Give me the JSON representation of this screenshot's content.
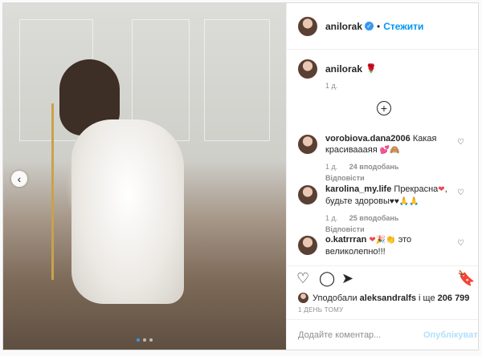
{
  "post": {
    "author": "anilorak",
    "follow_label": "Стежити",
    "separator": "•",
    "verified_mark": "✓"
  },
  "caption": {
    "user": "anilorak",
    "emoji": "🌹",
    "time": "1 д."
  },
  "load_more_icon": "+",
  "comments": [
    {
      "user": "vorobiova.dana2006",
      "text": "Какая красиваааяя",
      "emoji": "💕🙈",
      "time": "1 д.",
      "likes": "24 вподобань",
      "reply": "Відповісти"
    },
    {
      "user": "karolina_my.life",
      "text": "Прекрасна",
      "emoji_a": "❤",
      "text2": ", будьте здоровы",
      "emoji_b": "♥♥🙏🙏",
      "time": "1 д.",
      "likes": "25 вподобань",
      "reply": "Відповісти"
    },
    {
      "user": "o.katrrran",
      "emoji": "❤🎉👏",
      "text": "это великолепно!!!"
    }
  ],
  "actions": {
    "like": "♡",
    "comment": "◯",
    "share": "➤",
    "save": "🔖"
  },
  "likes": {
    "prefix": "Уподобали",
    "user": "aleksandralfs",
    "middle": "і ще",
    "count": "206 799"
  },
  "date": "1 ДЕНЬ ТОМУ",
  "add_comment": {
    "placeholder": "Додайте коментар...",
    "publish": "Опублікувати"
  },
  "carousel": {
    "slide_count": 3,
    "active_slide": 1,
    "prev_icon": "‹"
  },
  "colors": {
    "link_blue": "#0095f6",
    "publish_disabled": "#b2dffc",
    "verified": "#3897f0",
    "heart_red": "#ed4956"
  }
}
